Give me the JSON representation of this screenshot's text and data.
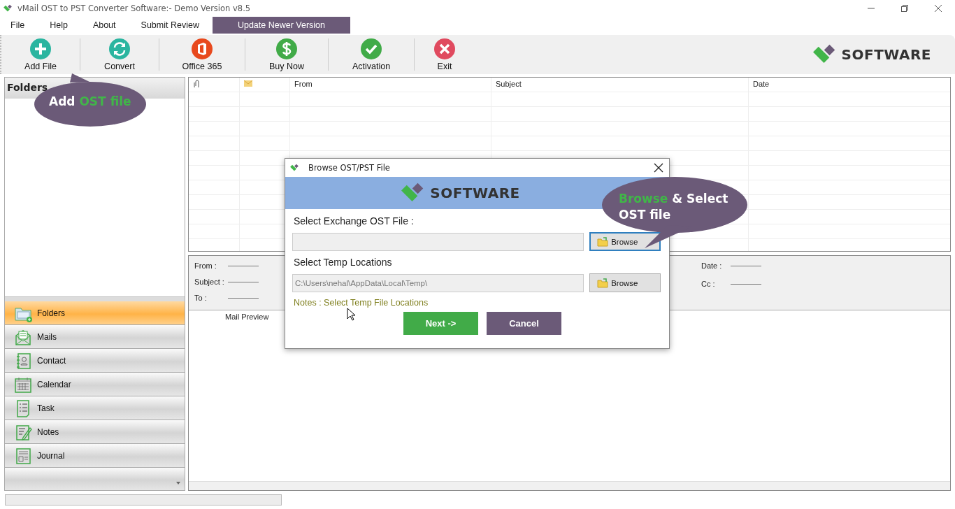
{
  "window": {
    "title": "vMail OST to PST Converter Software:- Demo Version v8.5"
  },
  "menu": [
    {
      "label": "File",
      "highlighted": false
    },
    {
      "label": "Help",
      "highlighted": false
    },
    {
      "label": "About",
      "highlighted": false
    },
    {
      "label": "Submit Review",
      "highlighted": false
    },
    {
      "label": "Update Newer Version",
      "highlighted": true
    }
  ],
  "toolbar": {
    "buttons": [
      {
        "label": "Add File",
        "kind": "add"
      },
      {
        "label": "Convert",
        "kind": "convert"
      },
      {
        "label": "Office 365",
        "kind": "office"
      },
      {
        "label": "Buy Now",
        "kind": "buy"
      },
      {
        "label": "Activation",
        "kind": "activate"
      },
      {
        "label": "Exit",
        "kind": "exit"
      }
    ],
    "logo": "SOFTWARE"
  },
  "folders_pane": {
    "title": "Folders"
  },
  "nav": [
    {
      "label": "Folders",
      "kind": "folder",
      "selected": true
    },
    {
      "label": "Mails",
      "kind": "mail",
      "selected": false
    },
    {
      "label": "Contact",
      "kind": "contact",
      "selected": false
    },
    {
      "label": "Calendar",
      "kind": "calendar",
      "selected": false
    },
    {
      "label": "Task",
      "kind": "task",
      "selected": false
    },
    {
      "label": "Notes",
      "kind": "notes",
      "selected": false
    },
    {
      "label": "Journal",
      "kind": "journal",
      "selected": false
    }
  ],
  "message_list": {
    "columns": [
      {
        "kind": "attachment"
      },
      {
        "kind": "envelope"
      },
      {
        "kind": "text",
        "label": "From"
      },
      {
        "kind": "text",
        "label": "Subject"
      },
      {
        "kind": "text",
        "label": "Date"
      }
    ]
  },
  "message_header": {
    "left": [
      {
        "label": "From :"
      },
      {
        "label": "Subject :"
      },
      {
        "label": "To :"
      }
    ],
    "right": [
      {
        "label": "Date :"
      },
      {
        "label": "Cc :"
      }
    ]
  },
  "preview_tabs": [
    {
      "label": "Mail Preview"
    }
  ],
  "status_bar": {
    "progress": {
      "level": 0
    }
  },
  "dialog": {
    "title": "Browse OST/PST File",
    "logo": "SOFTWARE",
    "sections": [
      {
        "label": "Select Exchange OST File :",
        "browse": {
          "label": "Browse",
          "focused": true
        }
      },
      {
        "label": "Select Temp Locations",
        "value": "C:\\Users\\nehal\\AppData\\Local\\Temp\\",
        "browse": {
          "label": "Browse",
          "focused": false
        }
      }
    ],
    "note": "Notes :  Select Temp File Locations",
    "buttons": [
      {
        "label": "Next ->",
        "kind": "primary"
      },
      {
        "label": "Cancel",
        "kind": "secondary"
      }
    ]
  },
  "callouts": [
    {
      "parts": [
        {
          "text": "Add ",
          "highlight": false
        },
        {
          "text": "OST file",
          "highlight": true
        }
      ]
    },
    {
      "parts": [
        {
          "text": "Browse",
          "highlight": true
        },
        {
          "text": " & Select OST file",
          "highlight": false
        }
      ]
    }
  ]
}
